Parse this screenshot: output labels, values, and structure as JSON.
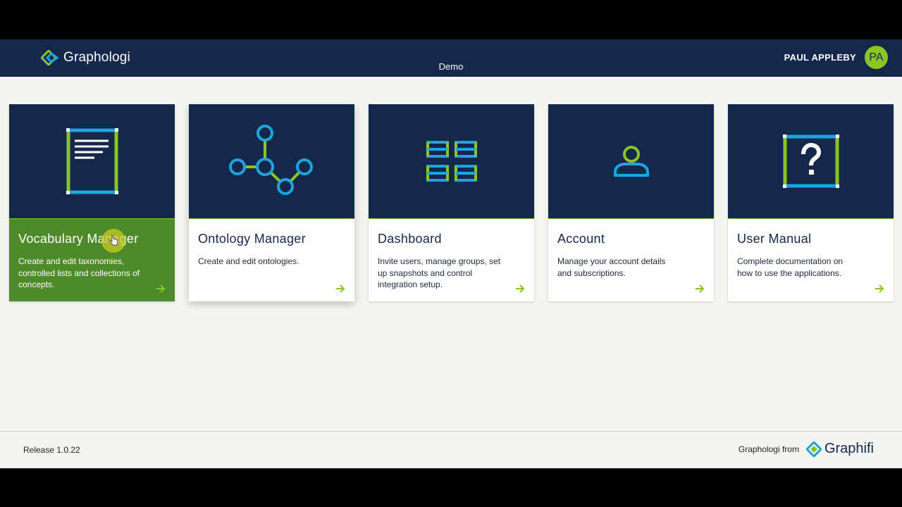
{
  "header": {
    "app_name": "Graphologi",
    "environment": "Demo",
    "user_name": "PAUL APPLEBY",
    "user_initials": "PA",
    "logo_icon": "graphologi-logo-icon"
  },
  "cards": [
    {
      "title": "Vocabulary Manager",
      "description": "Create and edit taxonomies, controlled lists and collections of concepts.",
      "icon": "document-icon"
    },
    {
      "title": "Ontology Manager",
      "description": "Create and edit ontologies.",
      "icon": "graph-nodes-icon"
    },
    {
      "title": "Dashboard",
      "description": "Invite users, manage groups, set up snapshots and control integration setup.",
      "icon": "grid-icon"
    },
    {
      "title": "Account",
      "description": "Manage your account details and subscriptions.",
      "icon": "user-icon"
    },
    {
      "title": "User Manual",
      "description": "Complete documentation on how to use the applications.",
      "icon": "question-icon"
    }
  ],
  "footer": {
    "release": "Release 1.0.22",
    "from_label": "Graphologi from",
    "brand": "Graphifi"
  },
  "colors": {
    "navy": "#14284b",
    "green": "#8ac623",
    "active_green": "#4f8a2a",
    "blue": "#1ea3dc"
  }
}
